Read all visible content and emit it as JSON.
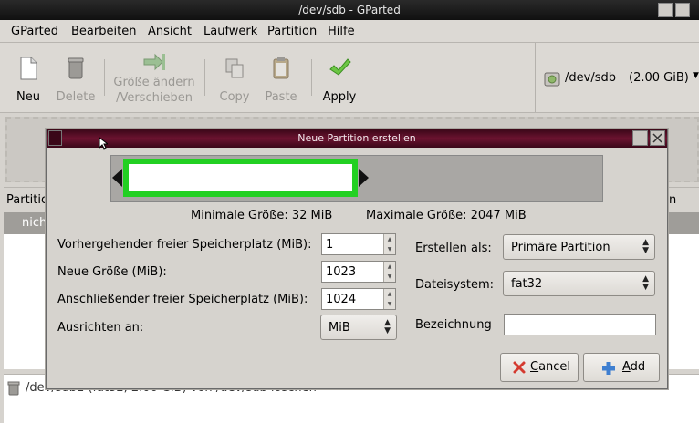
{
  "window": {
    "title": "/dev/sdb - GParted"
  },
  "menubar": {
    "items": [
      {
        "first": "G",
        "rest": "Parted"
      },
      {
        "first": "B",
        "rest": "earbeiten"
      },
      {
        "first": "A",
        "rest": "nsicht"
      },
      {
        "first": "L",
        "rest": "aufwerk"
      },
      {
        "first": "P",
        "rest": "artition"
      },
      {
        "first": "H",
        "rest": "ilfe"
      }
    ]
  },
  "toolbar": {
    "new": "Neu",
    "delete": "Delete",
    "resize_line1": "Größe ändern",
    "resize_line2": "/Verschieben",
    "copy": "Copy",
    "paste": "Paste",
    "apply": "Apply"
  },
  "device": {
    "name": "/dev/sdb",
    "size": "(2.00 GiB)"
  },
  "background": {
    "list_header_partial": "Partitio",
    "list_header_right_partial": "n",
    "list_row_partial": "nich",
    "operation": "/dev/sdb1 (fat32, 2.00 GiB) von /dev/sdb löschen"
  },
  "dialog": {
    "title": "Neue Partition erstellen",
    "min_size": "Minimale Größe: 32 MiB",
    "max_size": "Maximale Größe: 2047 MiB",
    "fields": {
      "free_before_label": "Vorhergehender freier Speicherplatz (MiB):",
      "free_before_value": "1",
      "new_size_label": "Neue Größe (MiB):",
      "new_size_value": "1023",
      "free_after_label": "Anschließender freier Speicherplatz (MiB):",
      "free_after_value": "1024",
      "align_label": "Ausrichten an:",
      "align_value": "MiB",
      "create_as_label": "Erstellen als:",
      "create_as_value": "Primäre Partition",
      "filesystem_label": "Dateisystem:",
      "filesystem_value": "fat32",
      "label_label": "Bezeichnung",
      "label_value": ""
    },
    "cancel": {
      "first": "C",
      "rest": "ancel"
    },
    "add": {
      "first": "A",
      "rest": "dd"
    },
    "partition_fill_fraction": 0.5,
    "colors": {
      "used_border": "#22d022",
      "free": "#a9a7a4",
      "title_bar": "#6b1330"
    }
  }
}
